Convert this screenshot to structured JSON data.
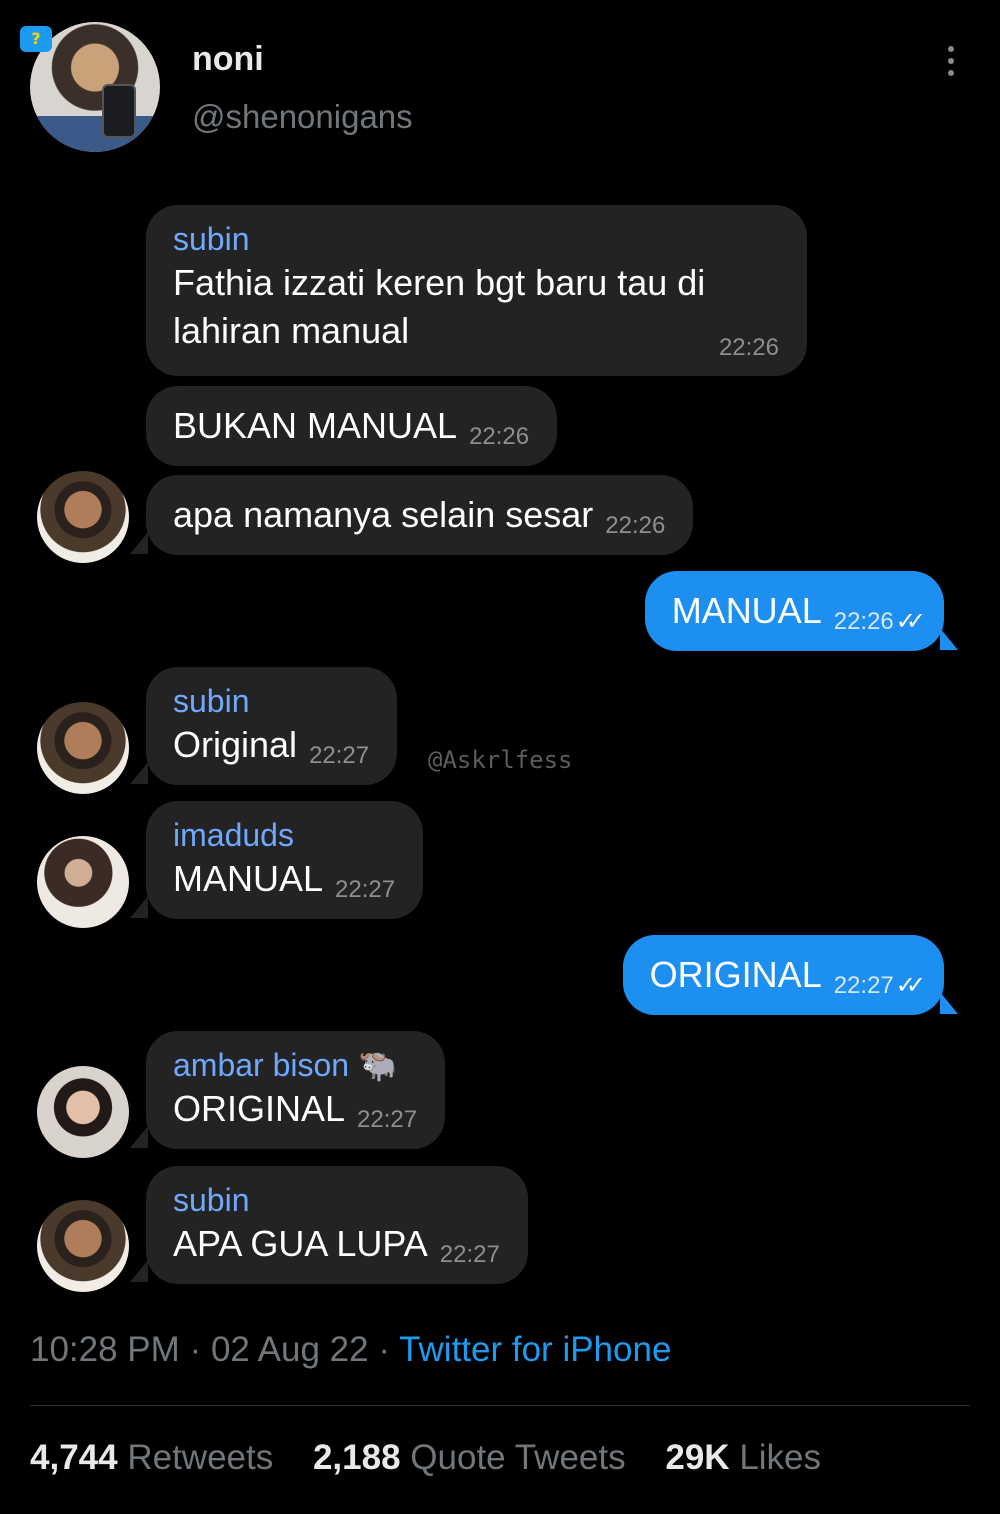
{
  "header": {
    "display_name": "noni",
    "handle": "@shenonigans",
    "more_icon": "more-vertical-icon"
  },
  "chat": {
    "messages": [
      {
        "id": "m1",
        "direction": "in",
        "sender": "subin",
        "text_lines": [
          "Fathia izzati keren bgt baru tau di",
          "lahiran manual"
        ],
        "time": "22:26"
      },
      {
        "id": "m2",
        "direction": "in",
        "sender": "",
        "text": "BUKAN MANUAL",
        "time": "22:26"
      },
      {
        "id": "m3",
        "direction": "in",
        "sender": "",
        "text": "apa namanya selain sesar",
        "time": "22:26",
        "avatar": "subin"
      },
      {
        "id": "m4",
        "direction": "out",
        "text": "MANUAL",
        "time": "22:26",
        "status_icon": "double-check-icon"
      },
      {
        "id": "m5",
        "direction": "in",
        "sender": "subin",
        "text": "Original",
        "time": "22:27",
        "avatar": "subin"
      },
      {
        "id": "m6",
        "direction": "in",
        "sender": "imaduds",
        "text": "MANUAL",
        "time": "22:27",
        "avatar": "imaduds"
      },
      {
        "id": "m7",
        "direction": "out",
        "text": "ORIGINAL",
        "time": "22:27",
        "status_icon": "double-check-icon"
      },
      {
        "id": "m8",
        "direction": "in",
        "sender": "ambar bison",
        "sender_emoji": "🐃",
        "text": "ORIGINAL",
        "time": "22:27",
        "avatar": "ambar"
      },
      {
        "id": "m9",
        "direction": "in",
        "sender": "subin",
        "text": "APA GUA LUPA",
        "time": "22:27",
        "avatar": "subin"
      }
    ],
    "watermark": "@Askrlfess"
  },
  "tweet_meta": {
    "time": "10:28 PM",
    "date": "02 Aug 22",
    "separator": "·",
    "source": "Twitter for iPhone"
  },
  "stats": {
    "retweets_count": "4,744",
    "retweets_label": "Retweets",
    "quotes_count": "2,188",
    "quotes_label": "Quote Tweets",
    "likes_count": "29K",
    "likes_label": "Likes"
  },
  "colors": {
    "background": "#000000",
    "bubble_in": "#232323",
    "bubble_out": "#1d8ff0",
    "sender_name": "#6fa8ff",
    "link": "#1d9bf0",
    "muted": "#71767b"
  }
}
